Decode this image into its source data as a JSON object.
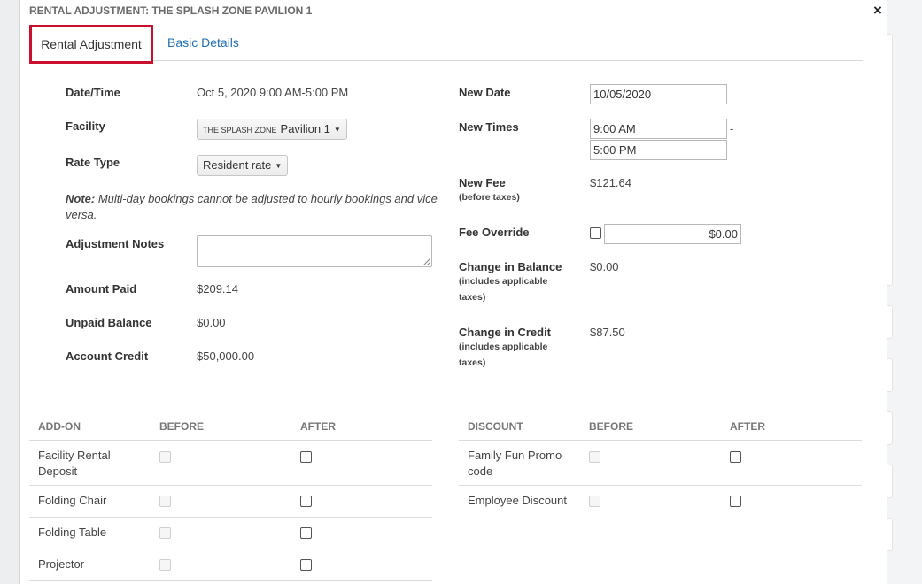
{
  "modal": {
    "title": "RENTAL ADJUSTMENT: THE SPLASH ZONE PAVILION 1",
    "close_label": "×"
  },
  "tabs": [
    {
      "label": "Rental Adjustment",
      "active": true
    },
    {
      "label": "Basic Details",
      "active": false
    }
  ],
  "left": {
    "datetime_label": "Date/Time",
    "datetime_value": "Oct 5, 2020 9:00 AM-5:00 PM",
    "facility_label": "Facility",
    "facility_prefix": "THE SPLASH ZONE",
    "facility_value": "Pavilion 1",
    "ratetype_label": "Rate Type",
    "ratetype_value": "Resident rate",
    "note_label": "Note:",
    "note_text": " Multi-day bookings cannot be adjusted to hourly bookings and vice versa.",
    "notes_label": "Adjustment Notes",
    "notes_value": "",
    "amount_paid_label": "Amount Paid",
    "amount_paid_value": "$209.14",
    "unpaid_label": "Unpaid Balance",
    "unpaid_value": "$0.00",
    "credit_label": "Account Credit",
    "credit_value": "$50,000.00"
  },
  "right": {
    "new_date_label": "New Date",
    "new_date_value": "10/05/2020",
    "new_times_label": "New Times",
    "new_time_start": "9:00 AM",
    "time_separator": "-",
    "new_time_end": "5:00 PM",
    "new_fee_label": "New Fee",
    "new_fee_sub": "(before taxes)",
    "new_fee_value": "$121.64",
    "fee_override_label": "Fee Override",
    "fee_override_value": "$0.00",
    "change_balance_label": "Change in Balance",
    "change_balance_sub": "(includes applicable taxes)",
    "change_balance_value": "$0.00",
    "change_credit_label": "Change in Credit",
    "change_credit_sub": "(includes applicable taxes)",
    "change_credit_value": "$87.50"
  },
  "addons": {
    "headers": [
      "ADD-ON",
      "BEFORE",
      "AFTER"
    ],
    "rows": [
      {
        "name": "Facility Rental Deposit"
      },
      {
        "name": "Folding Chair"
      },
      {
        "name": "Folding Table"
      },
      {
        "name": "Projector"
      }
    ]
  },
  "discounts": {
    "headers": [
      "DISCOUNT",
      "BEFORE",
      "AFTER"
    ],
    "rows": [
      {
        "name": "Family Fun Promo code"
      },
      {
        "name": "Employee Discount"
      }
    ]
  },
  "colors": {
    "accent_border": "#c8102e",
    "link": "#1f6fb2"
  }
}
